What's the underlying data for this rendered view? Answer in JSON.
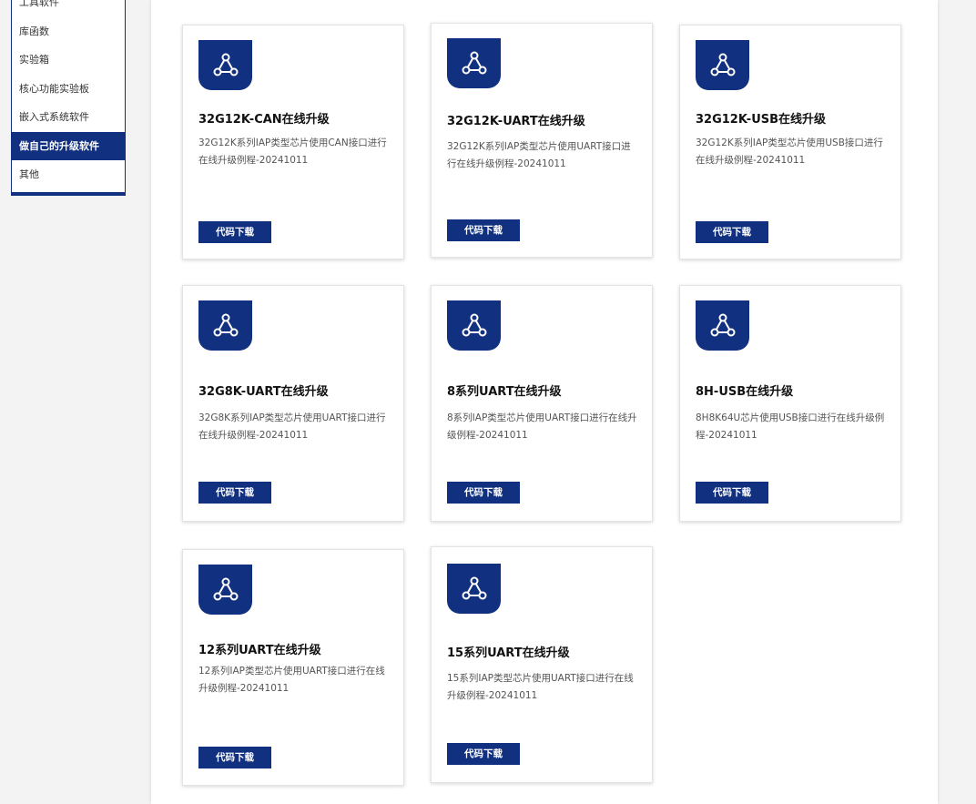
{
  "sidebar": {
    "items": [
      {
        "label": "工具软件",
        "active": false
      },
      {
        "label": "库函数",
        "active": false
      },
      {
        "label": "实验箱",
        "active": false
      },
      {
        "label": "核心功能实验板",
        "active": false
      },
      {
        "label": "嵌入式系统软件",
        "active": false
      },
      {
        "label": "做自己的升级软件",
        "active": true
      },
      {
        "label": "其他",
        "active": false
      }
    ]
  },
  "colors": {
    "accent": "#11307f",
    "panel": "#ffffff",
    "page_bg": "#f3f3f3"
  },
  "cards": [
    {
      "icon": "network-share-icon",
      "title": "32G12K-CAN在线升级",
      "desc": "32G12K系列IAP类型芯片使用CAN接口进行在线升级例程-20241011",
      "button": "代码下载"
    },
    {
      "icon": "network-share-icon",
      "title": "32G12K-UART在线升级",
      "desc": "32G12K系列IAP类型芯片使用UART接口进行在线升级例程-20241011",
      "button": "代码下载"
    },
    {
      "icon": "network-share-icon",
      "title": "32G12K-USB在线升级",
      "desc": "32G12K系列IAP类型芯片使用USB接口进行在线升级例程-20241011",
      "button": "代码下载"
    },
    {
      "icon": "network-share-icon",
      "title": "32G8K-UART在线升级",
      "desc": "32G8K系列IAP类型芯片使用UART接口进行在线升级例程-20241011",
      "button": "代码下载"
    },
    {
      "icon": "network-share-icon",
      "title": "8系列UART在线升级",
      "desc": "8系列IAP类型芯片使用UART接口进行在线升级例程-20241011",
      "button": "代码下载"
    },
    {
      "icon": "network-share-icon",
      "title": "8H-USB在线升级",
      "desc": "8H8K64U芯片使用USB接口进行在线升级例程-20241011",
      "button": "代码下载"
    },
    {
      "icon": "network-share-icon",
      "title": "12系列UART在线升级",
      "desc": "12系列IAP类型芯片使用UART接口进行在线升级例程-20241011",
      "button": "代码下载"
    },
    {
      "icon": "network-share-icon",
      "title": "15系列UART在线升级",
      "desc": "15系列IAP类型芯片使用UART接口进行在线升级例程-20241011",
      "button": "代码下载"
    }
  ]
}
